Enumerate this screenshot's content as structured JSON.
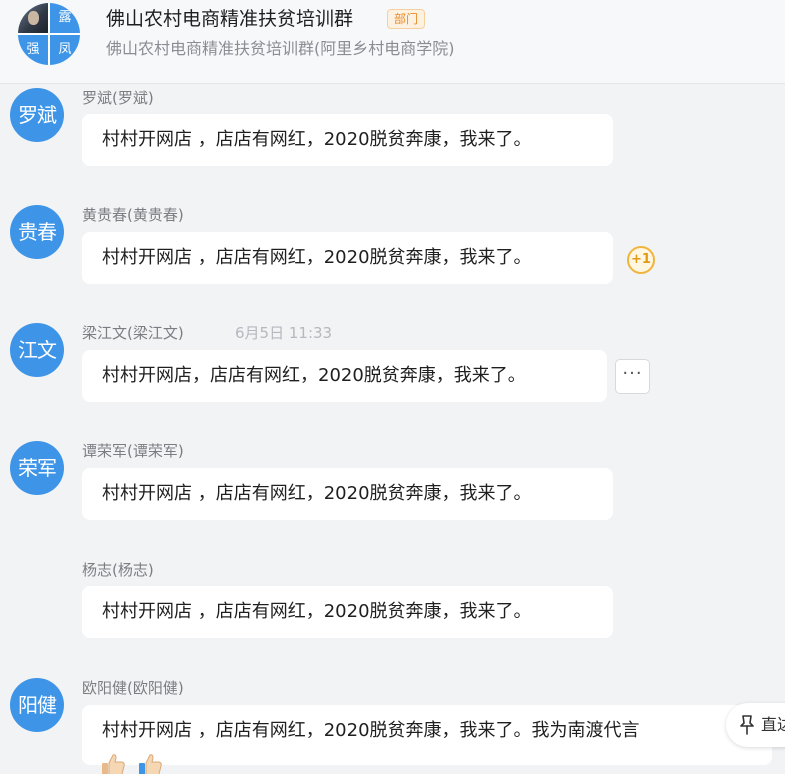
{
  "header": {
    "title": "佛山农村电商精准扶贫培训群",
    "badge": "部门",
    "subtitle": "佛山农村电商精准扶贫培训群(阿里乡村电商学院)",
    "avatar_tiles": [
      "露",
      "强",
      "凤"
    ]
  },
  "messages": [
    {
      "avatar_text": "罗斌",
      "sender": "罗斌(罗斌)",
      "text": "村村开网店 ，店店有网红，2020脱贫奔康，我来了。"
    },
    {
      "avatar_text": "贵春",
      "sender": "黄贵春(黄贵春)",
      "text": "村村开网店 ，店店有网红，2020脱贫奔康，我来了。",
      "reaction": "+1"
    },
    {
      "avatar_text": "江文",
      "sender": "梁江文(梁江文)",
      "time": "6月5日 11:33",
      "text": "村村开网店，店店有网红，2020脱贫奔康，我来了。",
      "more": "···"
    },
    {
      "avatar_text": "荣军",
      "sender": "谭荣军(谭荣军)",
      "text": "村村开网店 ，店店有网红，2020脱贫奔康，我来了。"
    },
    {
      "sender": "杨志(杨志)",
      "text": "村村开网店 ，店店有网红，2020脱贫奔康，我来了。"
    },
    {
      "avatar_text": "阳健",
      "sender": "欧阳健(欧阳健)",
      "text": "村村开网店 ，店店有网红，2020脱贫奔康，我来了。我为南渡代言"
    }
  ],
  "reply_button": {
    "label": "直达"
  },
  "colors": {
    "avatar_blue": "#3e95e8",
    "badge_orange": "#e98b2a",
    "reaction_gold": "#f0b43c"
  }
}
